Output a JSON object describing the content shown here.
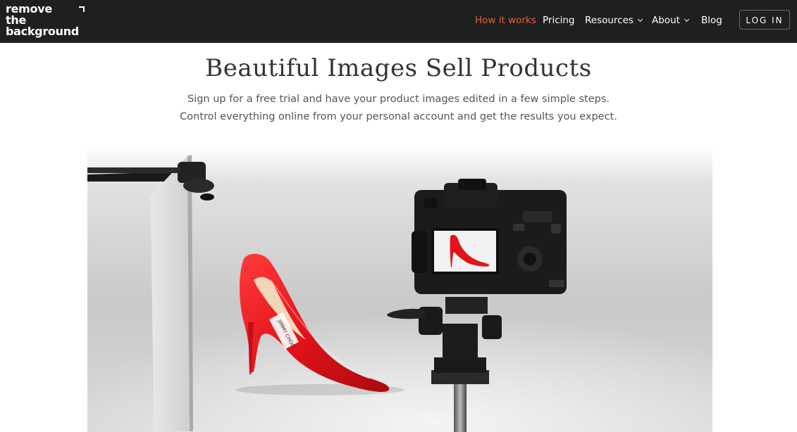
{
  "brand": {
    "logo_line1": "remove",
    "logo_line2": "the",
    "logo_line3": "background"
  },
  "nav": {
    "items": [
      {
        "label": "How it works",
        "active": true
      },
      {
        "label": "Pricing"
      },
      {
        "label": "Resources",
        "dropdown": true
      },
      {
        "label": "About",
        "dropdown": true
      },
      {
        "label": "Blog"
      }
    ],
    "login_label": "LOG IN",
    "active_color": "#e8603c"
  },
  "hero": {
    "title": "Beautiful Images Sell Products",
    "subtitle_line1": "Sign up for a free trial and have your product images edited in a few simple steps.",
    "subtitle_line2": "Control everything online from your personal account and get the results you expect.",
    "shoe_label": "JIMMY CHOO",
    "shoe_color": "#e5121a"
  }
}
